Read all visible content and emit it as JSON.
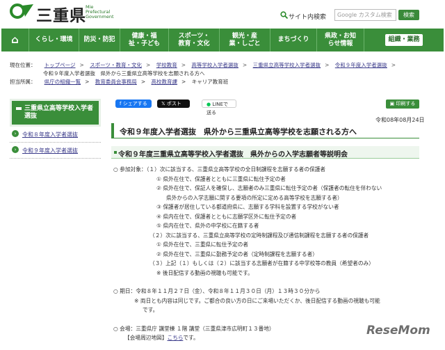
{
  "header": {
    "logo_jp": "三重県",
    "logo_en_1": "Mie",
    "logo_en_2": "Prefectural",
    "logo_en_3": "Government",
    "sitesearch_label": "サイト内検索",
    "search_placeholder": "Google カスタム検索",
    "search_button": "検索"
  },
  "gnav": [
    {
      "label": "⌂"
    },
    {
      "label": "くらし・環境"
    },
    {
      "label": "防災・防犯"
    },
    {
      "label": "健康・福祉・子ども"
    },
    {
      "label": "スポーツ・教育・文化"
    },
    {
      "label": "観光・産業・しごと"
    },
    {
      "label": "まちづくり"
    },
    {
      "label": "県政・お知らせ情報"
    },
    {
      "label": "組織・業務"
    }
  ],
  "breadcrumb": {
    "prefix": "現在位置：",
    "items": [
      "トップページ",
      "スポーツ・教育・文化",
      "学校教育",
      "高等学校入学者選抜",
      "三重県立高等学校入学者選抜",
      "令和９年度入学者選抜"
    ],
    "current": "令和９年度入学者選抜　県外から三重県立高等学校を志願される方へ"
  },
  "dept": {
    "prefix": "担当所属：",
    "items": [
      "県庁の組織一覧",
      "教育委員会事務局",
      "高校教育課",
      "キャリア教育班"
    ]
  },
  "sidebar": {
    "heading": "三重県立高等学校入学者選抜",
    "items": [
      {
        "label": "令和８年度入学者選抜"
      },
      {
        "label": "令和９年度入学者選抜"
      }
    ]
  },
  "social": {
    "facebook": "シェアする",
    "x": "ポスト",
    "line": "LINEで送る",
    "print": "印刷する"
  },
  "date": "令和08年08月24日",
  "page_title": "令和９年度入学者選抜　県外から三重県立高等学校を志願される方へ",
  "section_title": "令和９年度三重県立高等学校入学者選抜　県外からの入学志願者等説明会",
  "body": {
    "l1": "○ 参加対象：（１）次に該当する、三重県立高等学校の全日制課程を志願する者の保護者",
    "l2": "① 県外在住で、保護者とともに三重県に転住予定の者",
    "l3": "② 県外在住で、保証人を確保し、志願者のみ三重県に転住予定の者（保護者の転住を伴わない",
    "l4": "県外からの入学志願に関する要項の所定に定める高等学校を志願する者）",
    "l5": "③ 保護者が居住している都道府県に、志願する学科を設置する学校がない者",
    "l6": "④ 県内在住で、保護者とともに志願学区外に転住予定の者",
    "l7": "⑤ 県内在住で、県外の中学校に在籍する者",
    "l8": "（２）次に該当する、三重県立高等学校の定時制課程及び通信制課程を志願する者の保護者",
    "l9": "① 県外在住で、三重県に転住予定の者",
    "l10": "② 県外在住で、三重県に勤務予定の者（定時制課程を志願する者）",
    "l11": "（３）上記（１）もしくは（２）に該当する志願者が在籍する中学校等の教員（希望者のみ）",
    "l12": "※ 後日配信する動画の視聴も可能です。",
    "l13": "○ 期日：令和８年１１月２７日（金）、令和８年１１月３０日（月）１３時３０分から",
    "l14": "※ 両日とも内容は同じです。ご都合の良い方の日にご来場いただくか、後日配信する動画の視聴も可能",
    "l15": "です。",
    "l16": "○ 会場：三重県庁 講堂棟 １階 講堂（三重県津市広明町１３番地）",
    "l17_prefix": "【会場周辺地図】",
    "l17_link": "こちら",
    "l17_suffix": "です。"
  },
  "watermark": "ReseMom"
}
